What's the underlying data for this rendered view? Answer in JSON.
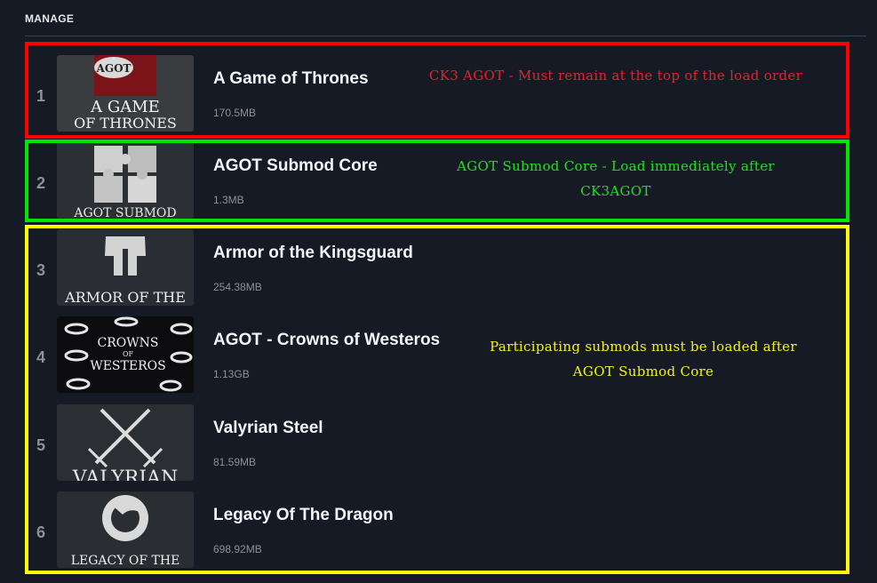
{
  "header": {
    "title": "MANAGE"
  },
  "mods": [
    {
      "index": "1",
      "name": "A Game of Thrones",
      "size": "170.5MB",
      "thumb_icon": "agot-logo-icon",
      "thumb_text_1": "AGOT",
      "thumb_text_2": "A GAME",
      "thumb_text_3": "OF THRONES"
    },
    {
      "index": "2",
      "name": "AGOT Submod Core",
      "size": "1.3MB",
      "thumb_icon": "puzzle-icon",
      "thumb_text_1": "AGOT SUBMOD"
    },
    {
      "index": "3",
      "name": "Armor of the Kingsguard",
      "size": "254.38MB",
      "thumb_icon": "helmet-icon",
      "thumb_text_1": "ARMOR OF THE"
    },
    {
      "index": "4",
      "name": "AGOT - Crowns of Westeros",
      "size": "1.13GB",
      "thumb_icon": "crowns-icon",
      "thumb_text_1": "CROWNS",
      "thumb_text_2": "OF",
      "thumb_text_3": "WESTEROS"
    },
    {
      "index": "5",
      "name": "Valyrian Steel",
      "size": "81.59MB",
      "thumb_icon": "crossed-swords-icon",
      "thumb_text_1": "VALYRIAN"
    },
    {
      "index": "6",
      "name": "Legacy Of The Dragon",
      "size": "698.92MB",
      "thumb_icon": "dragon-sigil-icon",
      "thumb_text_1": "LEGACY OF THE"
    }
  ],
  "annotations": {
    "red": {
      "text": "CK3 AGOT - Must remain at the top of the load order",
      "color": "#e8202a"
    },
    "green": {
      "line1": "AGOT Submod Core - Load immediately after",
      "line2": "CK3AGOT",
      "color": "#1fe21f"
    },
    "yellow": {
      "line1": "Participating submods must be loaded after",
      "line2": "AGOT Submod Core",
      "color": "#f2f21a"
    }
  },
  "colors": {
    "background": "#151a25",
    "red_box": "#ff0000",
    "green_box": "#00e600",
    "yellow_box": "#ffff00"
  }
}
